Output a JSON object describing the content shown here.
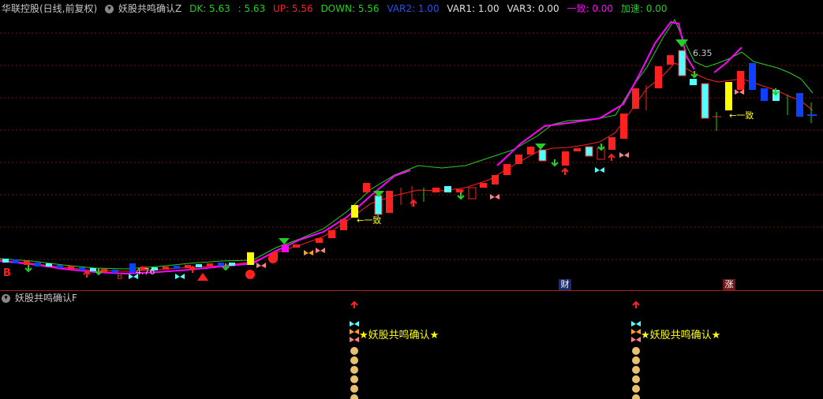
{
  "main": {
    "stock_name": "华联控股(日线,前复权)",
    "indicator": "妖股共鸣确认Z",
    "dk_label": "DK: 5.63",
    "dk2_label": ": 5.63",
    "up_label": "UP: 5.56",
    "down_label": "DOWN: 5.56",
    "var2_label": "VAR2: 1.00",
    "var1_label": "VAR1: 1.00",
    "var3_label": "VAR3: 0.00",
    "yizhi_label": "一致: 0.00",
    "jiasu_label": "加速: 0.00",
    "low_price_label": "4.76",
    "high_price_label": "6.35",
    "consensus_text_1": "←一致",
    "consensus_text_2": "←一致",
    "b_marker_1": "B",
    "b_marker_2": "B",
    "cai_tag": "财",
    "zhang_tag": "涨"
  },
  "sub": {
    "indicator": "妖股共鸣确认F",
    "signal_text_1": "★妖股共鸣确认★",
    "signal_text_2": "★妖股共鸣确认★"
  },
  "colors": {
    "up_candle": "#ff2020",
    "down_candle": "#54ffff",
    "green_line": "#22d022",
    "magenta_line": "#ff00ff",
    "yellow": "#ffff00",
    "grid": "#7a1010",
    "blue": "#1040ff"
  },
  "chart_data": {
    "type": "candlestick",
    "y_high_label": 6.35,
    "y_low_label": 4.76
  }
}
